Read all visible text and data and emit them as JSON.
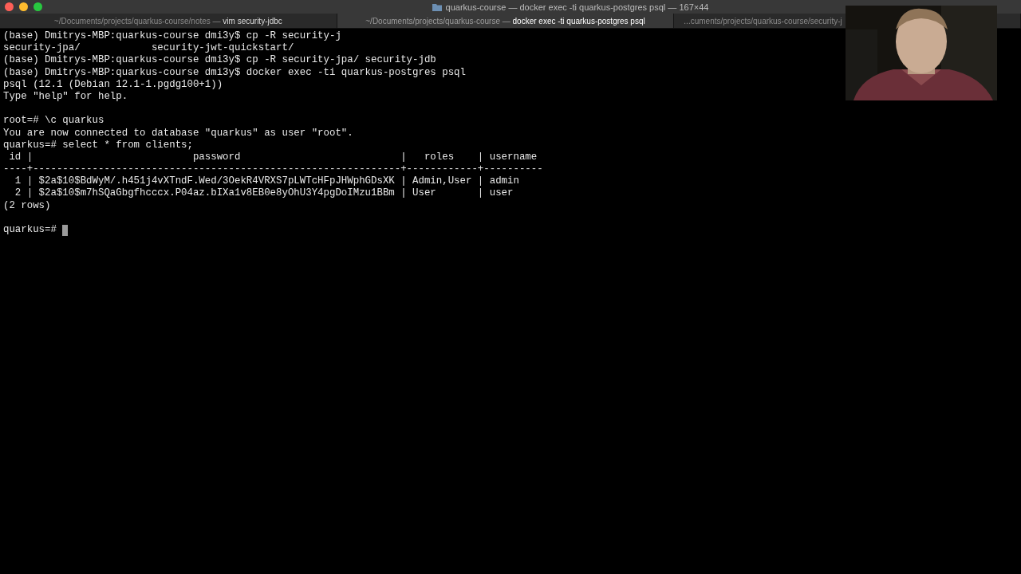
{
  "window": {
    "title": "quarkus-course — docker exec -ti quarkus-postgres psql — 167×44"
  },
  "tabs": [
    {
      "path": "~/Documents/projects/quarkus-course/notes — ",
      "command": "vim security-jdbc",
      "selected": false
    },
    {
      "path": "~/Documents/projects/quarkus-course — ",
      "command": "docker exec -ti quarkus-postgres psql",
      "selected": true
    },
    {
      "path": "...cuments/projects/quarkus-course/security-j",
      "selected": false
    }
  ],
  "terminal": {
    "lines": [
      {
        "kind": "text",
        "text": "(base) Dmitrys-MBP:quarkus-course dmi3y$ cp -R security-j"
      },
      {
        "kind": "text",
        "text": "security-jpa/            security-jwt-quickstart/"
      },
      {
        "kind": "text",
        "text": "(base) Dmitrys-MBP:quarkus-course dmi3y$ cp -R security-jpa/ security-jdb"
      },
      {
        "kind": "text",
        "text": "(base) Dmitrys-MBP:quarkus-course dmi3y$ docker exec -ti quarkus-postgres psql"
      },
      {
        "kind": "text",
        "text": "psql (12.1 (Debian 12.1-1.pgdg100+1))"
      },
      {
        "kind": "text",
        "text": "Type \"help\" for help."
      },
      {
        "kind": "blank"
      },
      {
        "kind": "text",
        "text": "root=# \\c quarkus"
      },
      {
        "kind": "text",
        "text": "You are now connected to database \"quarkus\" as user \"root\"."
      },
      {
        "kind": "text",
        "text": "quarkus=# select * from clients;"
      },
      {
        "kind": "text",
        "text": " id |                           password                           |   roles    | username"
      },
      {
        "kind": "text",
        "text": "----+--------------------------------------------------------------+------------+----------"
      },
      {
        "kind": "text",
        "text": "  1 | $2a$10$BdWyM/.h451j4vXTndF.Wed/3OekR4VRXS7pLWTcHFpJHWphGDsXK | Admin,User | admin"
      },
      {
        "kind": "text",
        "text": "  2 | $2a$10$m7hSQaGbgfhcccx.P04az.bIXa1v8EB0e8yOhU3Y4pgDoIMzu1BBm | User       | user"
      },
      {
        "kind": "text",
        "text": "(2 rows)"
      },
      {
        "kind": "blank"
      }
    ],
    "prompt": {
      "text": "quarkus=# ",
      "cursor": true
    }
  }
}
